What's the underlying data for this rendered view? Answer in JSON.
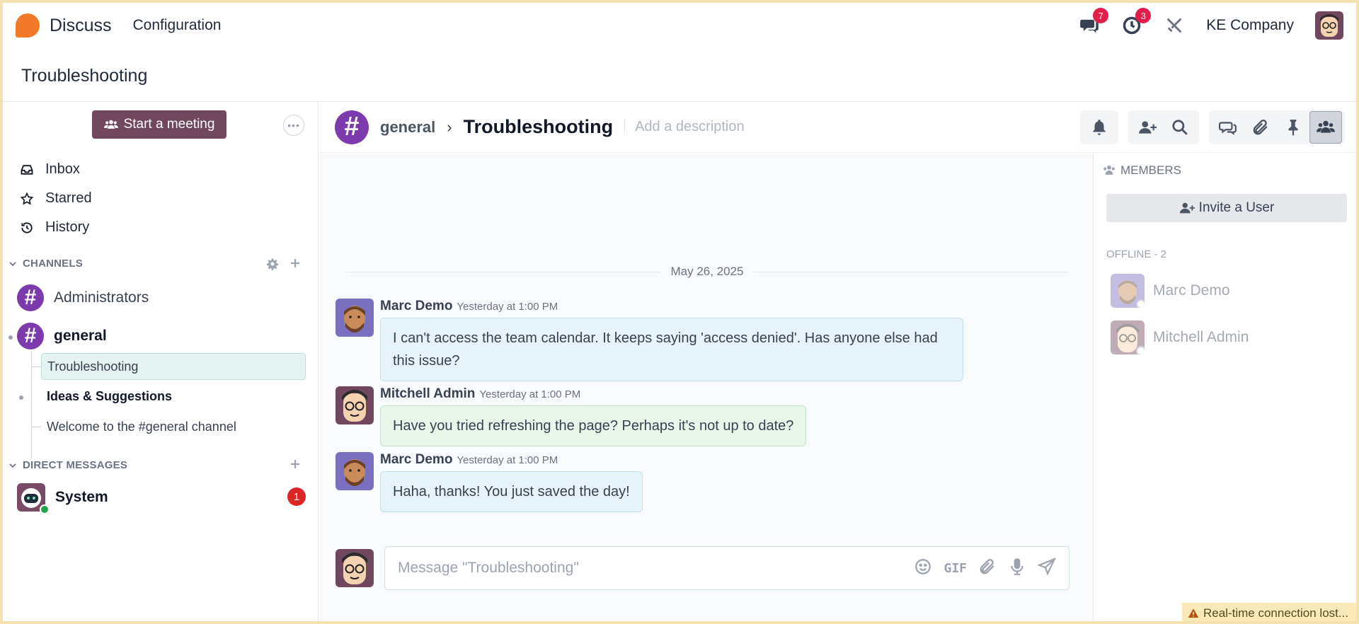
{
  "navbar": {
    "app_name": "Discuss",
    "menu": "Configuration",
    "messages_count": "7",
    "activities_count": "3",
    "company": "KE Company"
  },
  "breadcrumb": {
    "title": "Troubleshooting"
  },
  "sidebar": {
    "meeting_button": "Start a meeting",
    "nav": [
      {
        "label": "Inbox",
        "icon": "inbox-icon"
      },
      {
        "label": "Starred",
        "icon": "star-icon"
      },
      {
        "label": "History",
        "icon": "history-icon"
      }
    ],
    "channels_header": "CHANNELS",
    "channels": [
      {
        "name": "Administrators"
      },
      {
        "name": "general"
      }
    ],
    "threads": [
      {
        "name": "Troubleshooting"
      },
      {
        "name": "Ideas & Suggestions"
      },
      {
        "name": "Welcome to the #general channel"
      }
    ],
    "dm_header": "DIRECT MESSAGES",
    "dms": [
      {
        "name": "System",
        "unread": "1"
      }
    ]
  },
  "thread": {
    "parent": "general",
    "title": "Troubleshooting",
    "description_placeholder": "Add a description",
    "date_separator": "May 26, 2025",
    "messages": [
      {
        "author": "Marc Demo",
        "time": "Yesterday at 1:00 PM",
        "text": "I can't access the team calendar. It keeps saying 'access denied'. Has anyone else had this issue?"
      },
      {
        "author": "Mitchell Admin",
        "time": "Yesterday at 1:00 PM",
        "text": "Have you tried refreshing the page? Perhaps it's not up to date?"
      },
      {
        "author": "Marc Demo",
        "time": "Yesterday at 1:00 PM",
        "text": "Haha, thanks! You just saved the day!"
      }
    ],
    "composer_placeholder": "Message \"Troubleshooting\"",
    "gif_label": "GIF"
  },
  "members": {
    "title": "MEMBERS",
    "invite_button": "Invite a User",
    "offline_label": "OFFLINE - 2",
    "list": [
      {
        "name": "Marc Demo"
      },
      {
        "name": "Mitchell Admin"
      }
    ]
  },
  "toast": {
    "text": "Real-time connection lost..."
  },
  "colors": {
    "accent": "#71475e",
    "channel": "#7c3aad",
    "logo": "#f2792a",
    "badge": "#e11d48",
    "online": "#22a34a"
  }
}
